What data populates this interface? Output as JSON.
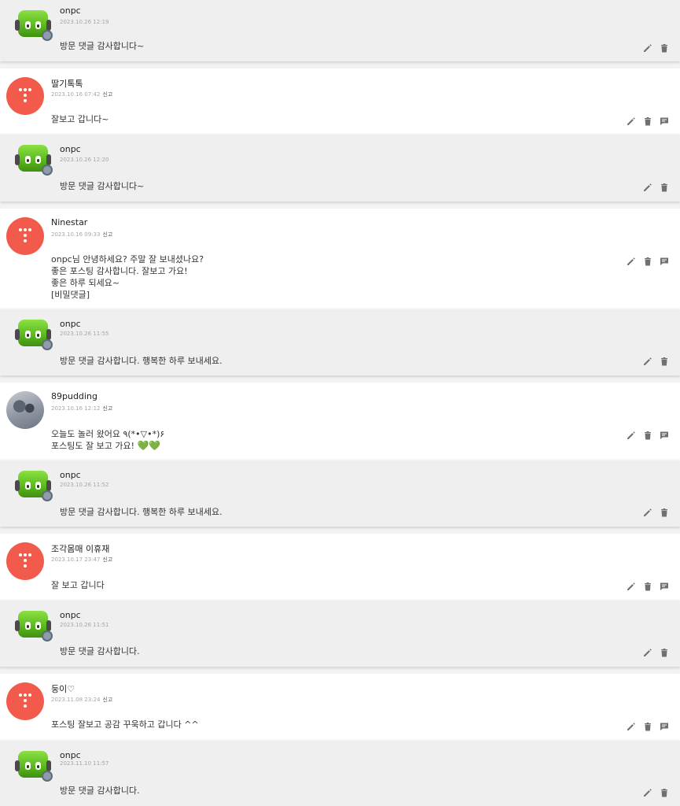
{
  "threads": [
    {
      "reply": {
        "name": "onpc",
        "date": "2023.10.26 12:19",
        "lines": [
          "방문 댓글 감사합니다~"
        ]
      }
    },
    {
      "comment": {
        "name": "딸기톡톡",
        "date": "2023.10.16 07:42",
        "report": "신고",
        "lines": [
          "잘보고 갑니다~"
        ]
      },
      "reply": {
        "name": "onpc",
        "date": "2023.10.26 12:20",
        "lines": [
          "방문 댓글 감사합니다~"
        ]
      }
    },
    {
      "comment": {
        "name": "Ninestar",
        "date": "2023.10.16 09:33",
        "report": "신고",
        "lines": [
          "onpc님 안녕하세요? 주말 잘 보내셨나요?",
          "좋은 포스팅 감사합니다. 잘보고 가요!",
          "좋은 하루 되세요~",
          "[비밀댓글]"
        ]
      },
      "reply": {
        "name": "onpc",
        "date": "2023.10.26 11:55",
        "lines": [
          "방문 댓글 감사합니다. 행복한 하루 보내세요."
        ]
      }
    },
    {
      "comment": {
        "name": "89pudding",
        "date": "2023.10.16 12:12",
        "report": "신고",
        "lines": [
          "오늘도 놀러 왔어요  ٩(*•▽•*)۶",
          "포스팅도 잘 보고 가요! "
        ],
        "hearts": "💚💚"
      },
      "reply": {
        "name": "onpc",
        "date": "2023.10.26 11:52",
        "lines": [
          "방문 댓글 감사합니다. 행복한 하루 보내세요."
        ]
      }
    },
    {
      "comment": {
        "name": "조각몸매 이휴재",
        "date": "2023.10.17 23:47",
        "report": "신고",
        "lines": [
          "잘 보고 갑니다"
        ]
      },
      "reply": {
        "name": "onpc",
        "date": "2023.10.26 11:51",
        "lines": [
          "방문 댓글 감사합니다."
        ]
      }
    },
    {
      "comment": {
        "name": "둥이♡",
        "date": "2023.11.08 23:24",
        "report": "신고",
        "lines": [
          "포스팅 잘보고 공감 꾸욱하고 갑니다 ^^"
        ]
      },
      "reply": {
        "name": "onpc",
        "date": "2023.11.10 11:57",
        "lines": [
          "방문 댓글 감사합니다."
        ]
      }
    }
  ],
  "icons": {
    "edit": "pencil-icon",
    "delete": "trash-icon",
    "reply": "reply-icon",
    "avatar_default": "tistory-dots-icon",
    "avatar_robot": "android-robot-icon"
  },
  "colors": {
    "avatar_red": "#f25b4c",
    "robot_green": "#59b71c",
    "reply_bg": "#efefef",
    "icon_gray": "#707070"
  }
}
